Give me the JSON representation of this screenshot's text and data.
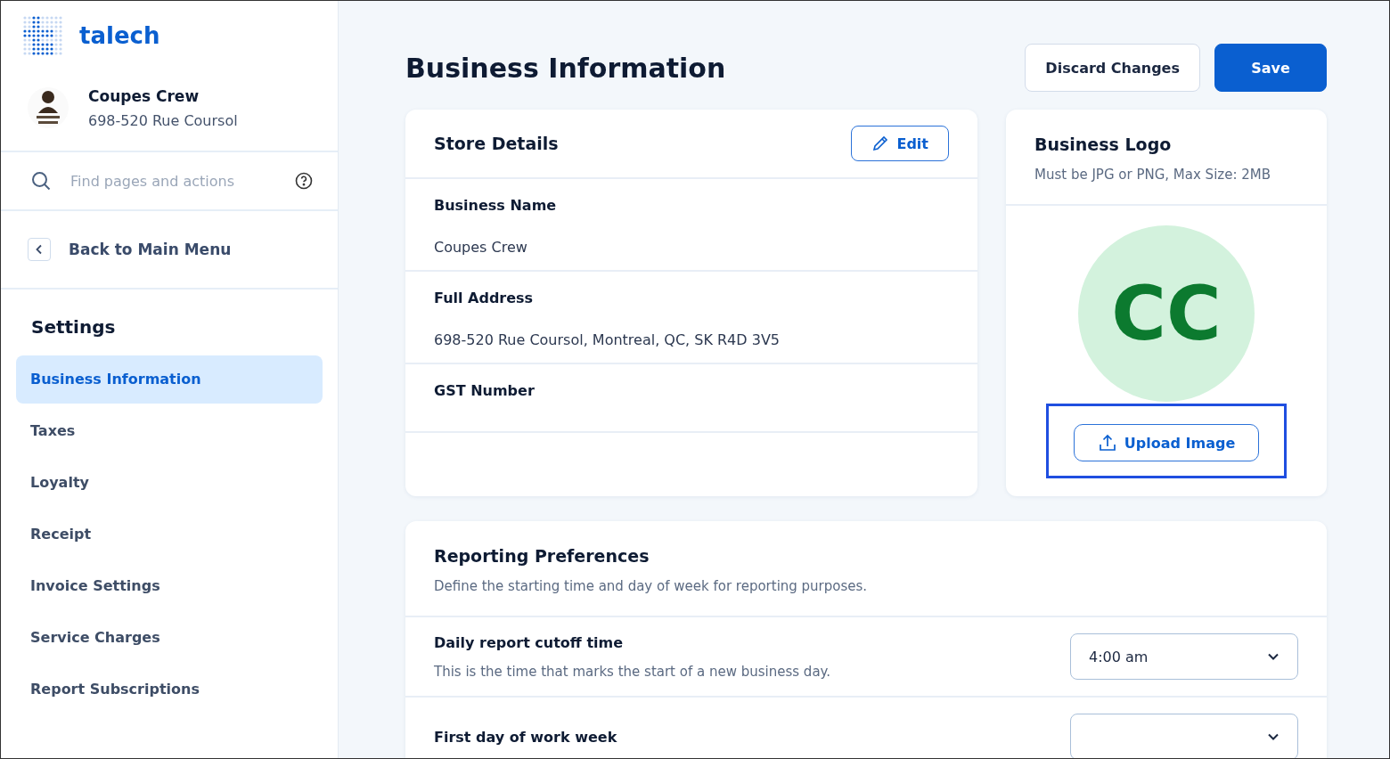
{
  "brand": {
    "name": "talech"
  },
  "business": {
    "name": "Coupes Crew",
    "address": "698-520 Rue Coursol"
  },
  "search": {
    "placeholder": "Find pages and actions"
  },
  "back": {
    "label": "Back to Main Menu"
  },
  "sidebar": {
    "heading": "Settings",
    "items": [
      {
        "label": "Business Information",
        "selected": true
      },
      {
        "label": "Taxes",
        "selected": false
      },
      {
        "label": "Loyalty",
        "selected": false
      },
      {
        "label": "Receipt",
        "selected": false
      },
      {
        "label": "Invoice Settings",
        "selected": false
      },
      {
        "label": "Service Charges",
        "selected": false
      },
      {
        "label": "Report Subscriptions",
        "selected": false
      }
    ]
  },
  "page": {
    "title": "Business Information",
    "buttons": [
      {
        "label": "Discard Changes",
        "kind": "secondary"
      },
      {
        "label": "Save",
        "kind": "primary"
      }
    ]
  },
  "store_details": {
    "title": "Store Details",
    "edit_label": "Edit",
    "fields": [
      {
        "label": "Business Name",
        "value": "Coupes Crew"
      },
      {
        "label": "Full Address",
        "value": "698-520 Rue Coursol, Montreal, QC, SK R4D 3V5"
      },
      {
        "label": "GST Number"
      }
    ]
  },
  "business_logo": {
    "title": "Business Logo",
    "hint": "Must be JPG or PNG, Max Size: 2MB",
    "initials": "CC",
    "upload_label": "Upload Image",
    "highlighted": true
  },
  "reporting": {
    "title": "Reporting Preferences",
    "description": "Define the starting time and day of week for reporting purposes.",
    "rows": [
      {
        "label": "Daily report cutoff time",
        "description": "This is the time that marks the start of a new business day.",
        "value": "4:00 am"
      },
      {
        "label": "First day of work week"
      }
    ]
  }
}
